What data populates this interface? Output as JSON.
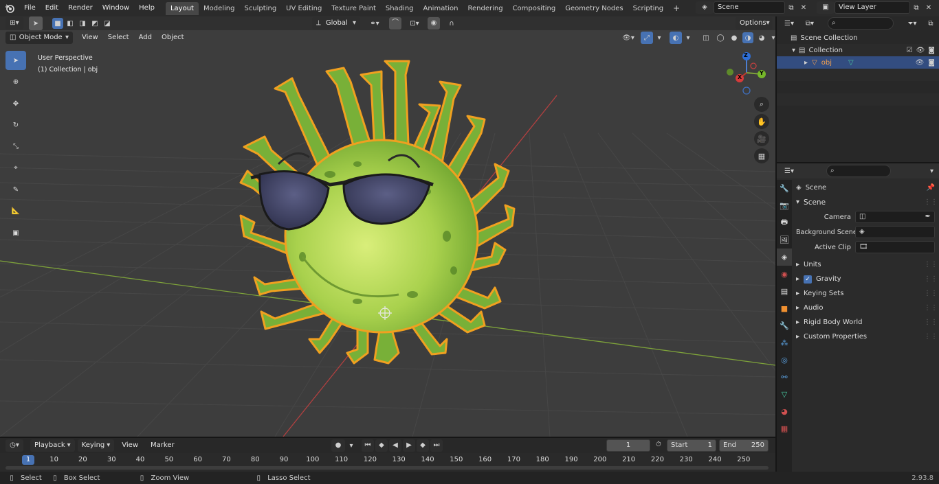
{
  "menu": {
    "items": [
      "File",
      "Edit",
      "Render",
      "Window",
      "Help"
    ]
  },
  "workspaces": [
    {
      "label": "Layout",
      "active": true
    },
    {
      "label": "Modeling"
    },
    {
      "label": "Sculpting"
    },
    {
      "label": "UV Editing"
    },
    {
      "label": "Texture Paint"
    },
    {
      "label": "Shading"
    },
    {
      "label": "Animation"
    },
    {
      "label": "Rendering"
    },
    {
      "label": "Compositing"
    },
    {
      "label": "Geometry Nodes"
    },
    {
      "label": "Scripting"
    }
  ],
  "add_workspace": "+",
  "scene_field": "Scene",
  "view_layer_field": "View Layer",
  "header": {
    "transform_orientation": "Global",
    "options": "Options"
  },
  "viewport_header": {
    "mode": "Object Mode",
    "menus": [
      "View",
      "Select",
      "Add",
      "Object"
    ]
  },
  "overlay": {
    "perspective": "User Perspective",
    "collection": "(1) Collection | obj"
  },
  "gizmo": {
    "z": "Z",
    "y": "Y",
    "x": "X"
  },
  "outliner": {
    "scene_collection": "Scene Collection",
    "collection": "Collection",
    "object": "obj"
  },
  "properties": {
    "header_title": "Scene",
    "panel_scene": "Scene",
    "fields": [
      {
        "label": "Camera"
      },
      {
        "label": "Background Scene"
      },
      {
        "label": "Active Clip"
      }
    ],
    "panels": [
      "Units",
      "Gravity",
      "Keying Sets",
      "Audio",
      "Rigid Body World",
      "Custom Properties"
    ]
  },
  "timeline": {
    "menus": [
      "Playback",
      "Keying",
      "View",
      "Marker"
    ],
    "current_frame": "1",
    "start_label": "Start",
    "start_value": "1",
    "end_label": "End",
    "end_value": "250",
    "ticks": [
      "1",
      "10",
      "20",
      "30",
      "40",
      "50",
      "60",
      "70",
      "80",
      "90",
      "100",
      "110",
      "120",
      "130",
      "140",
      "150",
      "160",
      "170",
      "180",
      "190",
      "200",
      "210",
      "220",
      "230",
      "240",
      "250"
    ]
  },
  "status": {
    "select": "Select",
    "box_select": "Box Select",
    "zoom_view": "Zoom View",
    "lasso_select": "Lasso Select",
    "version": "2.93.8"
  },
  "colors": {
    "accent": "#4772b3",
    "selection_outline": "#f0a020",
    "virus_green": "#8bc34a",
    "x_axis": "#c0392b",
    "y_axis": "#7fae3a"
  }
}
